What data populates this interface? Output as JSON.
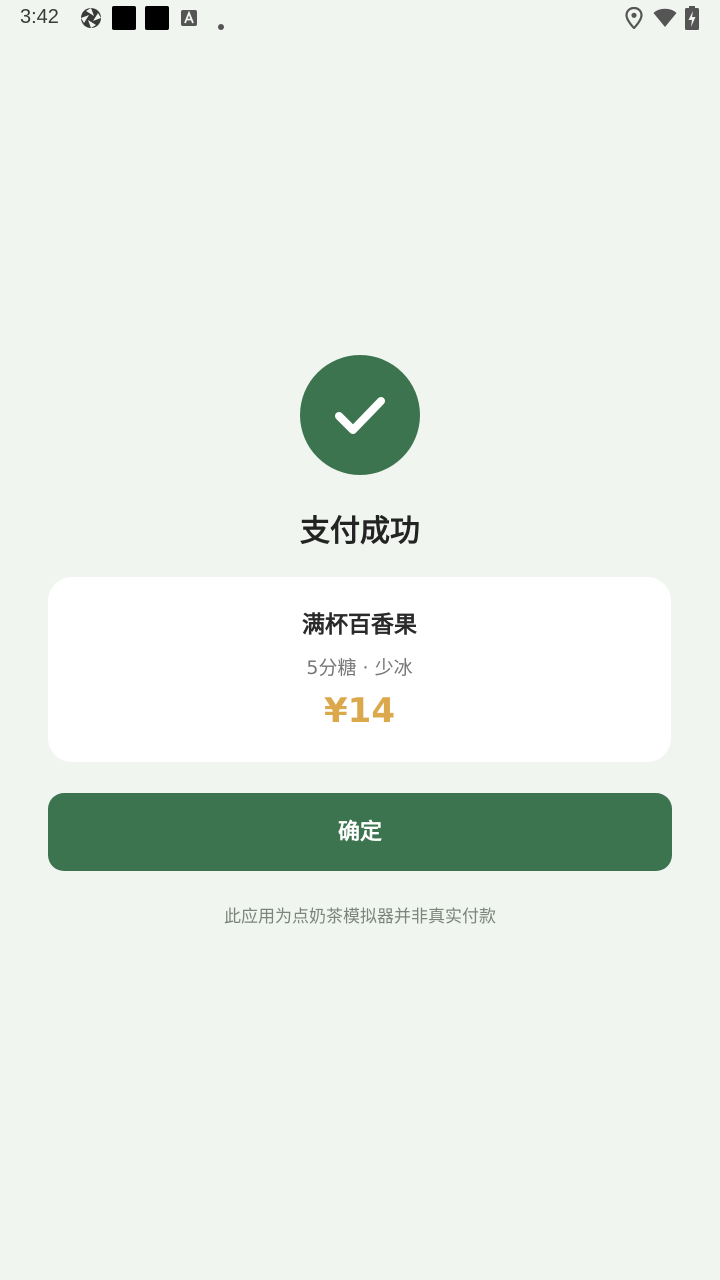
{
  "status_bar": {
    "time": "3:42",
    "icons": [
      "aperture-icon",
      "notification-square-icon",
      "notification-square-icon",
      "translate-icon",
      "dot-icon",
      "location-icon",
      "wifi-icon",
      "battery-charging-icon"
    ]
  },
  "colors": {
    "background": "#f1f5f0",
    "accent": "#3c7450",
    "price": "#dba84b"
  },
  "success": {
    "icon": "checkmark-icon",
    "title": "支付成功"
  },
  "order": {
    "product_name": "满杯百香果",
    "options": "5分糖 · 少冰",
    "price": "¥14"
  },
  "confirm_button": {
    "label": "确定"
  },
  "disclaimer": "此应用为点奶茶模拟器并非真实付款"
}
